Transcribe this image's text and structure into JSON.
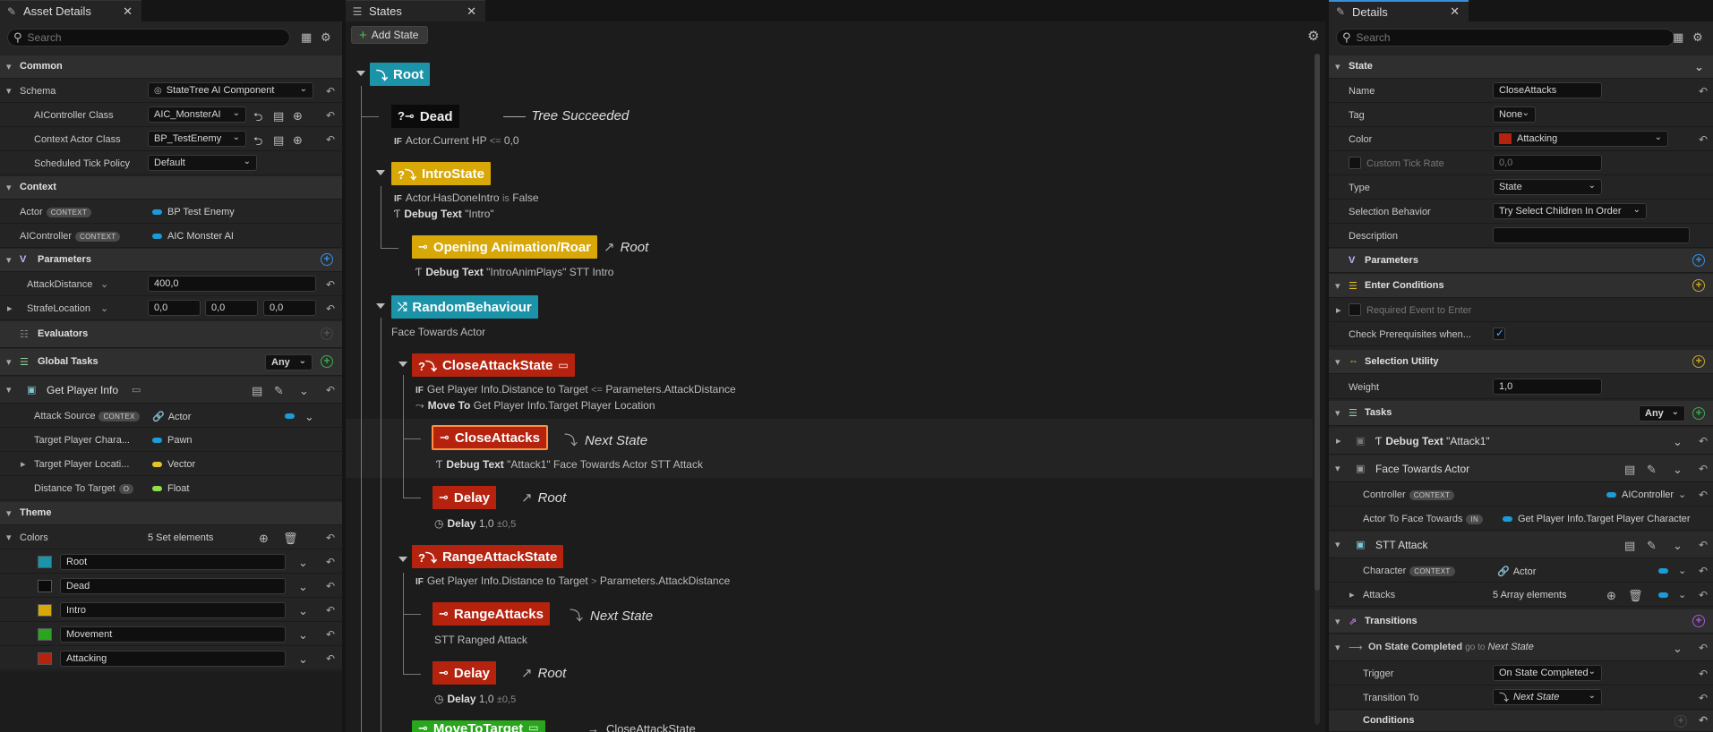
{
  "left": {
    "tab_title": "Asset Details",
    "search_placeholder": "Search",
    "common_header": "Common",
    "schema_label": "Schema",
    "schema_value": "StateTree AI Component",
    "aicontroller_class_label": "AIController Class",
    "aicontroller_class_value": "AIC_MonsterAI",
    "context_actor_class_label": "Context Actor Class",
    "context_actor_class_value": "BP_TestEnemy",
    "tick_policy_label": "Scheduled Tick Policy",
    "tick_policy_value": "Default",
    "context_header": "Context",
    "actor_label": "Actor",
    "context_badge": "CONTEXT",
    "actor_value": "BP Test Enemy",
    "aicontroller_label": "AIController",
    "aicontroller_value": "AIC Monster AI",
    "parameters_header": "Parameters",
    "attack_distance_label": "AttackDistance",
    "attack_distance_value": "400,0",
    "strafe_label": "StrafeLocation",
    "strafe_x": "0,0",
    "strafe_y": "0,0",
    "strafe_z": "0,0",
    "evaluators_header": "Evaluators",
    "global_tasks_header": "Global Tasks",
    "global_tasks_any": "Any",
    "get_player_info": "Get Player Info",
    "attack_source_label": "Attack Source",
    "attack_source_badge": "CONTEX",
    "attack_source_value": "Actor",
    "target_char_label": "Target Player Chara...",
    "target_char_value": "Pawn",
    "target_loc_label": "Target Player Locati...",
    "target_loc_value": "Vector",
    "distance_label": "Distance To Target",
    "distance_badge": "O",
    "distance_value": "Float",
    "theme_header": "Theme",
    "colors_label": "Colors",
    "colors_value": "5 Set elements",
    "theme_colors": [
      {
        "name": "Root",
        "color": "#1b93a8"
      },
      {
        "name": "Dead",
        "color": "#0b0b0b"
      },
      {
        "name": "Intro",
        "color": "#d8a808"
      },
      {
        "name": "Movement",
        "color": "#2aa51e"
      },
      {
        "name": "Attacking",
        "color": "#b5230f"
      }
    ]
  },
  "mid": {
    "tab_title": "States",
    "add_state": "Add State",
    "root": "Root",
    "dead": "Dead",
    "dead_trans": "Tree Succeeded",
    "dead_cond_if": "IF",
    "dead_cond": "Actor.Current HP",
    "dead_cond_op": "<=",
    "dead_cond_val": "0,0",
    "intro": "IntroState",
    "intro_cond_if": "IF",
    "intro_cond": "Actor.HasDoneIntro",
    "intro_cond_op": "is",
    "intro_cond_val": "False",
    "intro_task_b": "Debug Text",
    "intro_task": "\"Intro\"",
    "opening": "Opening Animation/Roar",
    "opening_trans": "Root",
    "opening_task_b": "Debug Text",
    "opening_task": "\"IntroAnimPlays\"   STT Intro",
    "random": "RandomBehaviour",
    "random_task": "Face Towards Actor",
    "close_state": "CloseAttackState",
    "close_cond_if": "IF",
    "close_cond": "Get Player Info.Distance to Target",
    "close_cond_op": "<=",
    "close_cond_val": "Parameters.AttackDistance",
    "close_task_b": "Move To",
    "close_task": "Get Player Info.Target Player Location",
    "close_attacks": "CloseAttacks",
    "close_attacks_trans": "Next State",
    "close_attacks_task_b": "Debug Text",
    "close_attacks_task": "\"Attack1\"   Face Towards Actor   STT Attack",
    "delay1": "Delay",
    "delay1_trans": "Root",
    "delay1_task_b": "Delay",
    "delay1_task": "1,0",
    "delay1_pm": "±0,5",
    "range_state": "RangeAttackState",
    "range_cond_if": "IF",
    "range_cond": "Get Player Info.Distance to Target",
    "range_cond_op": ">",
    "range_cond_val": "Parameters.AttackDistance",
    "range_attacks": "RangeAttacks",
    "range_attacks_trans": "Next State",
    "range_attacks_task": "STT Ranged Attack",
    "delay2": "Delay",
    "delay2_trans": "Root",
    "delay2_task_b": "Delay",
    "delay2_task": "1,0",
    "delay2_pm": "±0,5",
    "move": "MoveToTarget",
    "move_trans": "CloseAttackState"
  },
  "right": {
    "tab_title": "Details",
    "search_placeholder": "Search",
    "state_header": "State",
    "name_label": "Name",
    "name_value": "CloseAttacks",
    "tag_label": "Tag",
    "tag_value": "None",
    "color_label": "Color",
    "color_value": "Attacking",
    "tick_label": "Custom Tick Rate",
    "tick_value": "0,0",
    "type_label": "Type",
    "type_value": "State",
    "selection_label": "Selection Behavior",
    "selection_value": "Try Select Children In Order",
    "description_label": "Description",
    "parameters_header": "Parameters",
    "enter_header": "Enter Conditions",
    "required_event": "Required Event to Enter",
    "check_prereq": "Check Prerequisites when...",
    "utility_header": "Selection Utility",
    "weight_label": "Weight",
    "weight_value": "1,0",
    "tasks_header": "Tasks",
    "tasks_any": "Any",
    "task1_b": "Debug Text",
    "task1": "\"Attack1\"",
    "task2": "Face Towards Actor",
    "controller_label": "Controller",
    "context_badge": "CONTEXT",
    "controller_value": "AIController",
    "actor_face_label": "Actor To Face Towards",
    "actor_face_badge": "IN",
    "actor_face_value": "Get Player Info.Target Player Character",
    "task3": "STT Attack",
    "character_label": "Character",
    "character_value": "Actor",
    "attacks_label": "Attacks",
    "attacks_value": "5 Array elements",
    "transitions_header": "Transitions",
    "on_state_b": "On State Completed",
    "on_state_go": "go to",
    "on_state_target": "Next State",
    "trigger_label": "Trigger",
    "trigger_value": "On State Completed",
    "transition_to_label": "Transition To",
    "transition_to_value": "Next State",
    "conditions_label": "Conditions"
  },
  "colors": {
    "root": "#1b93a8",
    "dead": "#0b0b0b",
    "intro": "#d8a808",
    "movement": "#2aa51e",
    "attacking": "#b5230f",
    "accent_blue": "#3a8fdb"
  }
}
